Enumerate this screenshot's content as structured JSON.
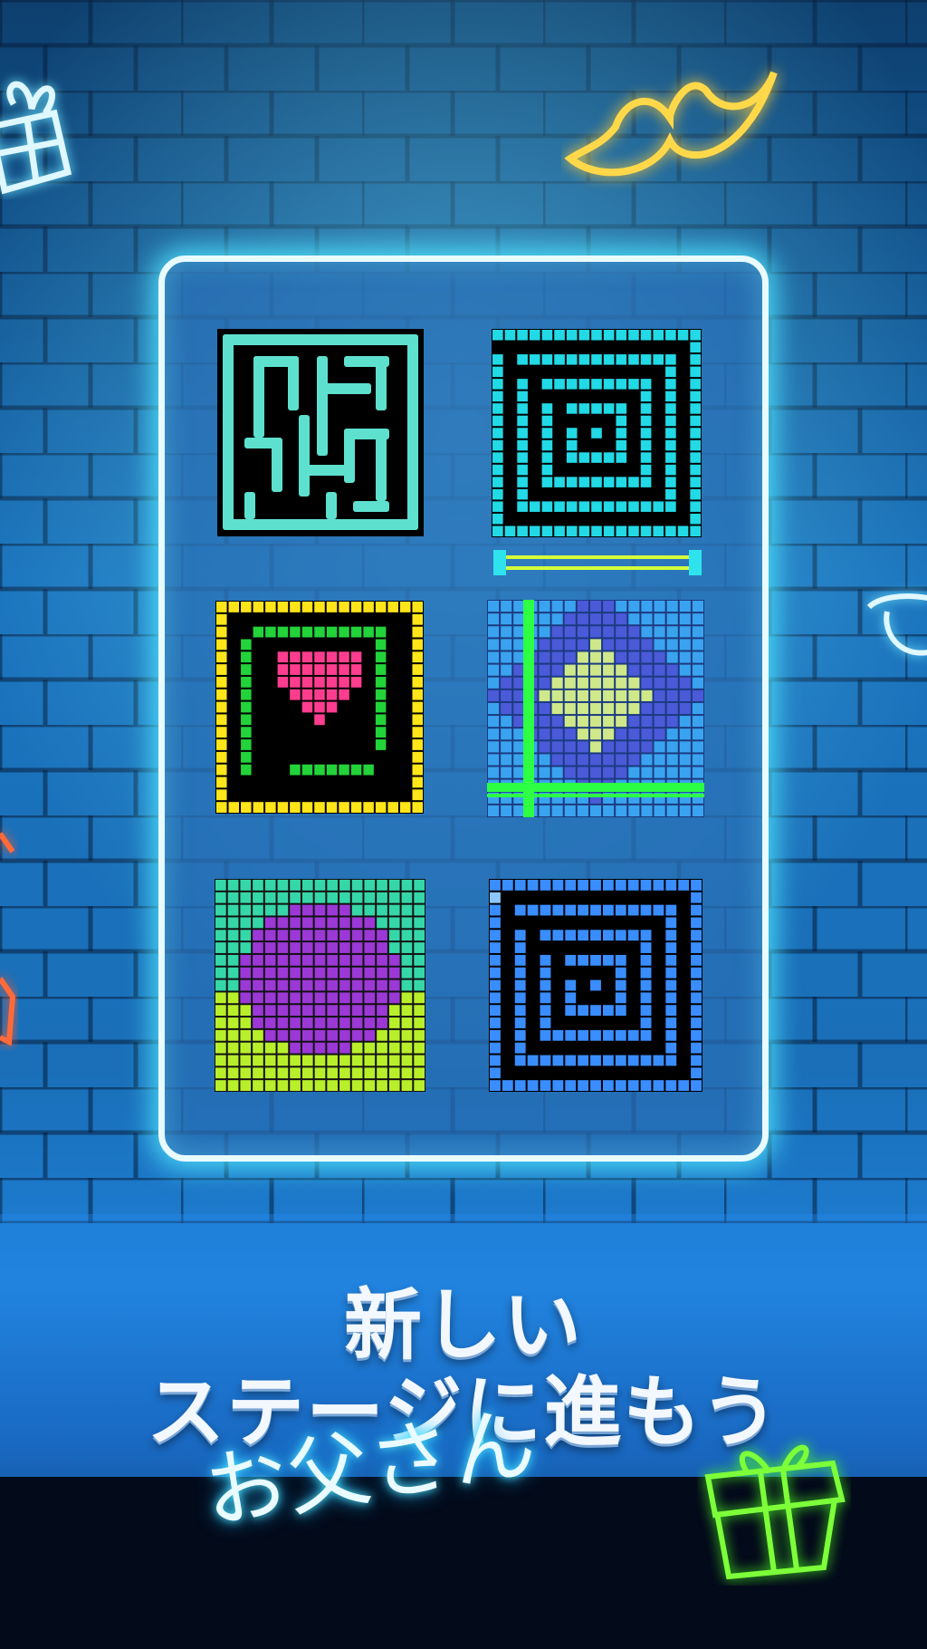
{
  "headline": {
    "line1": "新しい",
    "line2": "ステージに進もう",
    "line3": "お父さん"
  },
  "panel": {
    "tiles": [
      {
        "name": "maze-puzzle",
        "palette": [
          "#5ee0cf",
          "#000000"
        ]
      },
      {
        "name": "cyan-spiral-puzzle",
        "palette": [
          "#22d9e6",
          "#000000"
        ]
      },
      {
        "name": "heart-puzzle",
        "palette": [
          "#ffe51a",
          "#22d33a",
          "#ff3d8f",
          "#000000"
        ]
      },
      {
        "name": "diamond-puzzle",
        "palette": [
          "#3aa3f0",
          "#4a5ad8",
          "#cfe88a",
          "#2cff44"
        ]
      },
      {
        "name": "purple-blob-puzzle",
        "palette": [
          "#b8ef2a",
          "#35d7a8",
          "#9b38d6"
        ]
      },
      {
        "name": "blue-spiral-puzzle",
        "palette": [
          "#3a8dff",
          "#8cc7ff",
          "#000000"
        ]
      }
    ]
  },
  "decorations": [
    "gift-icon",
    "mustache-icon",
    "glasses-icon",
    "gift-icon"
  ],
  "colors": {
    "brick": "#1668b0",
    "glow": "#56e8ff",
    "accent_yellow": "#ffd84a",
    "accent_green": "#7dff3a"
  }
}
